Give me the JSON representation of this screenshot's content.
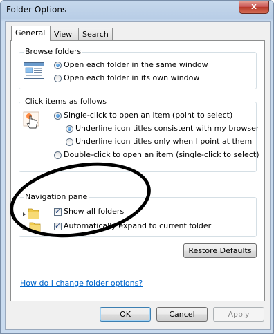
{
  "window": {
    "title": "Folder Options",
    "close_label": "x"
  },
  "tabs": [
    {
      "label": "General",
      "active": true
    },
    {
      "label": "View",
      "active": false
    },
    {
      "label": "Search",
      "active": false
    }
  ],
  "browse_folders": {
    "label": "Browse folders",
    "options": [
      {
        "label": "Open each folder in the same window",
        "selected": true
      },
      {
        "label": "Open each folder in its own window",
        "selected": false
      }
    ]
  },
  "click_items": {
    "label": "Click items as follows",
    "single_click": {
      "label": "Single-click to open an item (point to select)",
      "selected": true
    },
    "underline_options": [
      {
        "label": "Underline icon titles consistent with my browser",
        "selected": true
      },
      {
        "label": "Underline icon titles only when I point at them",
        "selected": false
      }
    ],
    "double_click": {
      "label": "Double-click to open an item (single-click to select)",
      "selected": false
    }
  },
  "navigation_pane": {
    "label": "Navigation pane",
    "options": [
      {
        "label": "Show all folders",
        "checked": true
      },
      {
        "label": "Automatically expand to current folder",
        "checked": true
      }
    ]
  },
  "restore_defaults_label": "Restore Defaults",
  "help_link": "How do I change folder options?",
  "footer": {
    "ok_label": "OK",
    "cancel_label": "Cancel",
    "apply_label": "Apply"
  },
  "icons": {
    "browse": "window-panes-icon",
    "click": "hand-pointer-icon",
    "nav_folder": "folder-icon",
    "expander": "triangle-expand-icon"
  },
  "colors": {
    "link": "#0066cc",
    "annotation": "#000000",
    "title_bar": "#b8cde6",
    "close_button": "#c75050"
  }
}
